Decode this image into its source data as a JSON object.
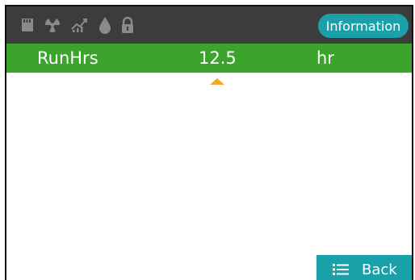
{
  "status_bar": {
    "icons": [
      "sd-card-icon",
      "radiation-icon",
      "trend-chart-icon",
      "water-drop-icon",
      "lock-icon"
    ],
    "info_button_label": "Information"
  },
  "parameter": {
    "name": "RunHrs",
    "value": "12.5",
    "unit": "hr"
  },
  "footer": {
    "back_label": "Back"
  },
  "colors": {
    "topbar": "#3c3c3c",
    "accent_teal": "#1aa0a8",
    "highlight_green": "#3aa52a",
    "caret_orange": "#f5a623",
    "icon_gray": "#8a8a8a"
  }
}
